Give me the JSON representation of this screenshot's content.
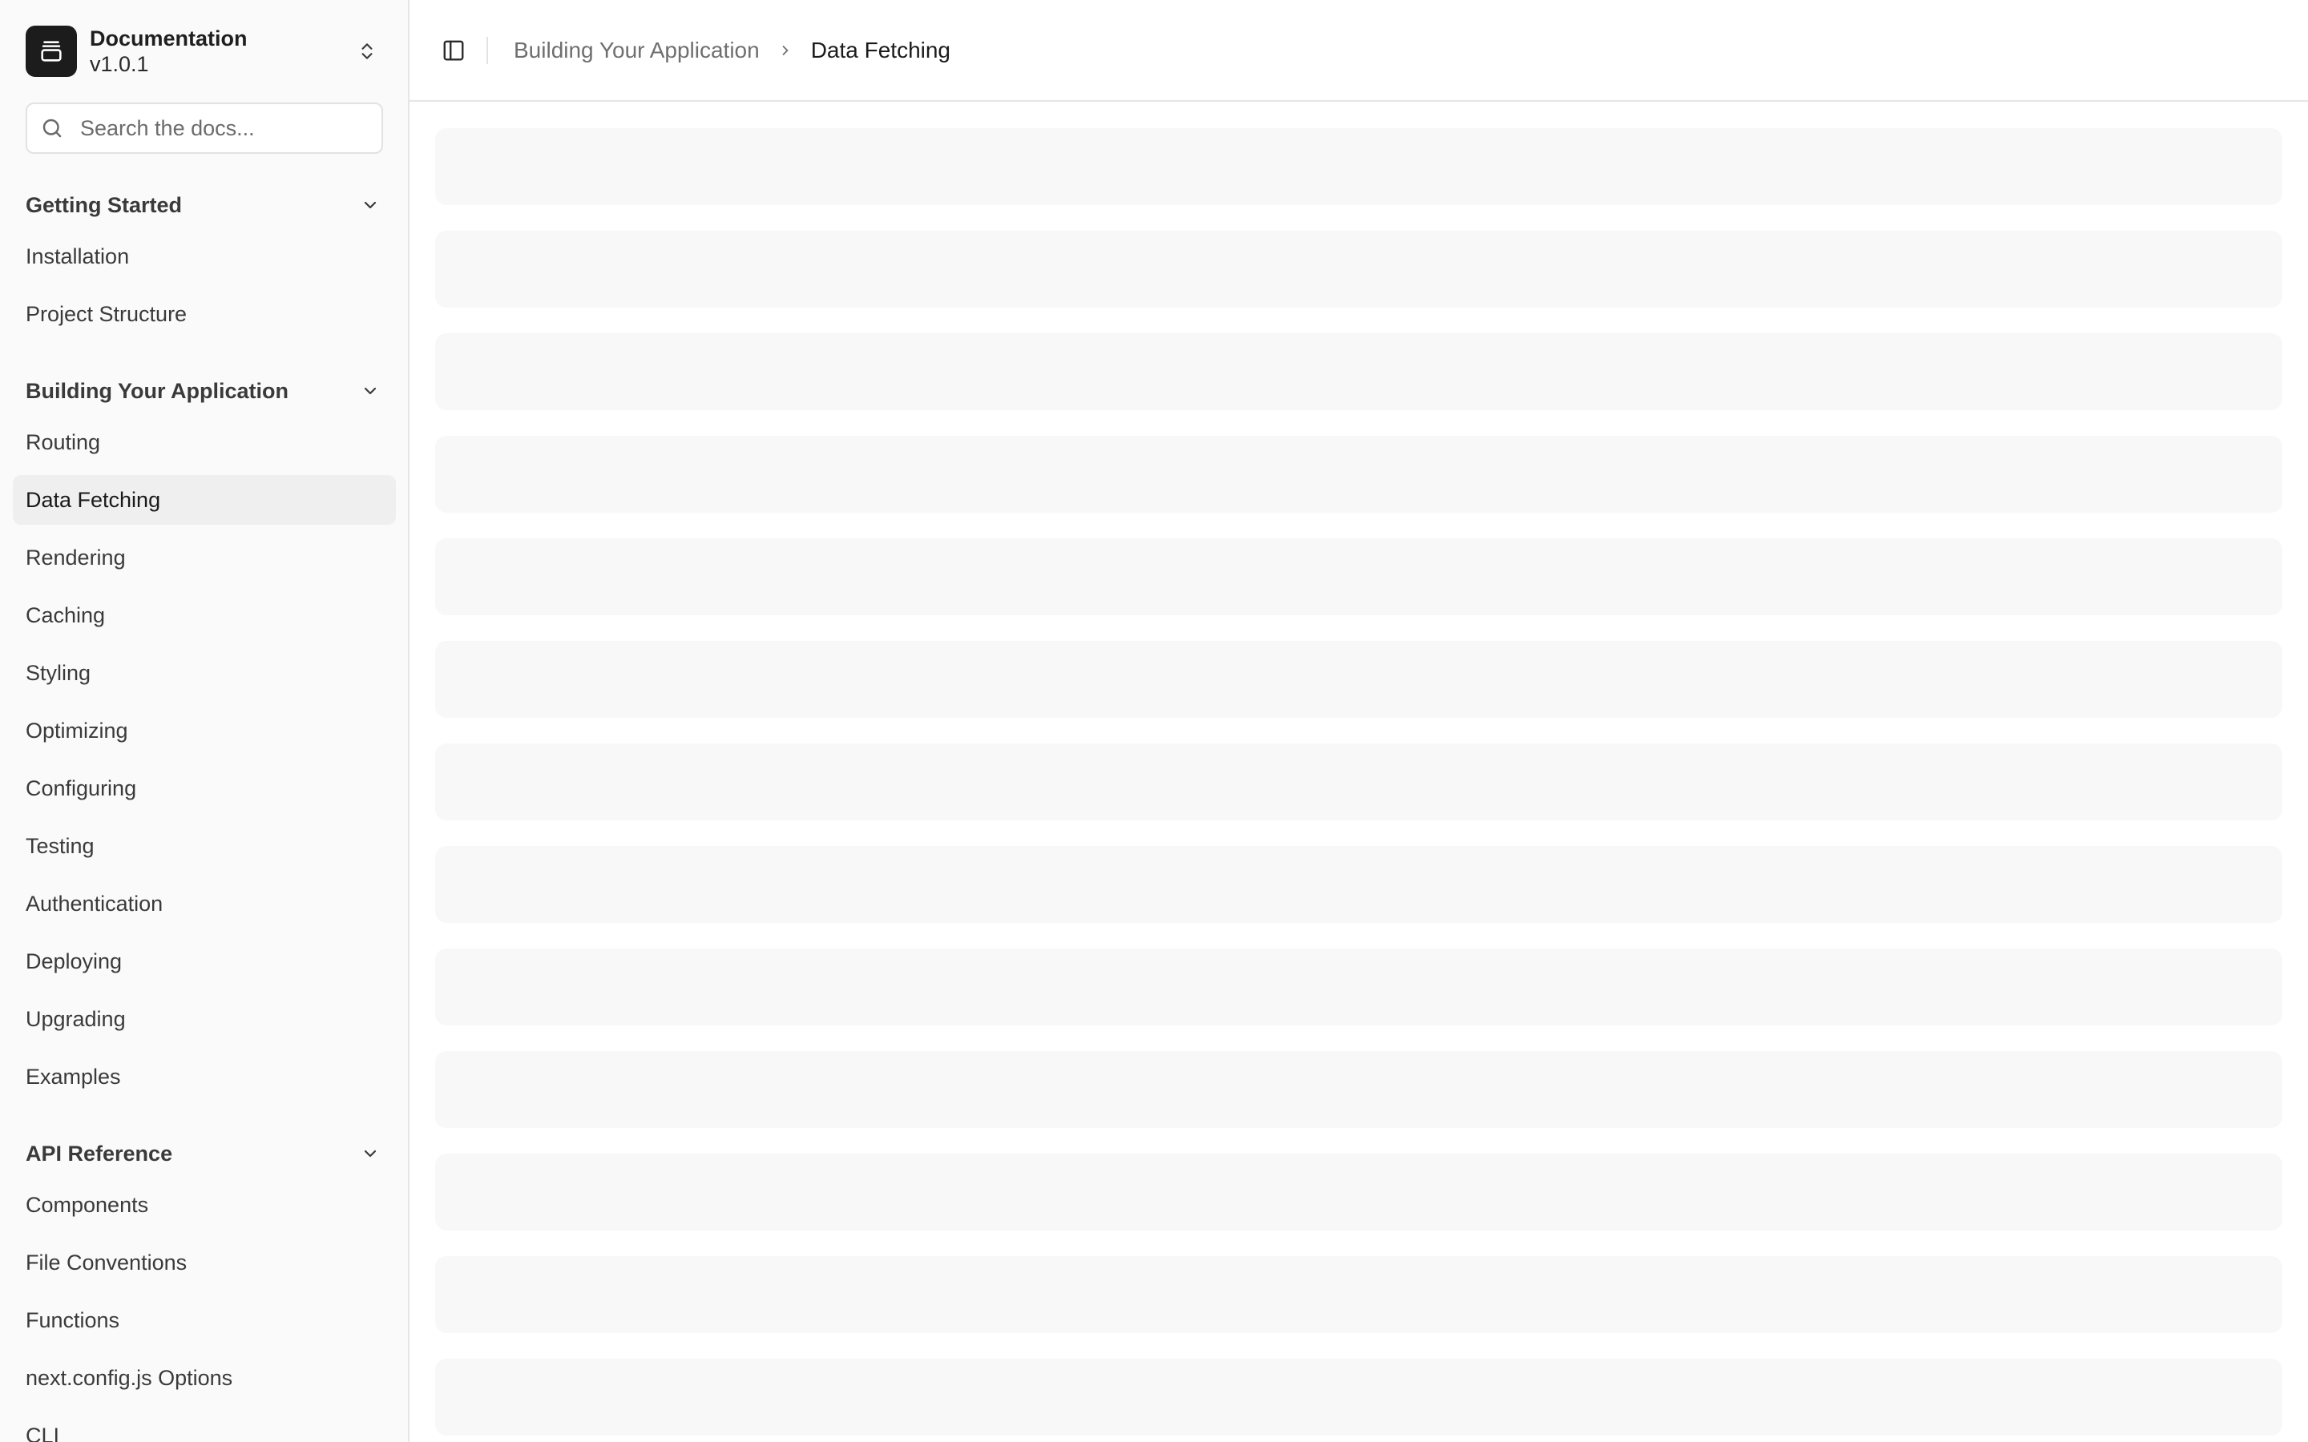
{
  "brand": {
    "title": "Documentation",
    "version": "v1.0.1"
  },
  "search": {
    "placeholder": "Search the docs..."
  },
  "sections": [
    {
      "title": "Getting Started",
      "items": [
        "Installation",
        "Project Structure"
      ]
    },
    {
      "title": "Building Your Application",
      "items": [
        "Routing",
        "Data Fetching",
        "Rendering",
        "Caching",
        "Styling",
        "Optimizing",
        "Configuring",
        "Testing",
        "Authentication",
        "Deploying",
        "Upgrading",
        "Examples"
      ]
    },
    {
      "title": "API Reference",
      "items": [
        "Components",
        "File Conventions",
        "Functions",
        "next.config.js Options",
        "CLI"
      ]
    }
  ],
  "active_item": "Data Fetching",
  "breadcrumb": {
    "parent": "Building Your Application",
    "current": "Data Fetching"
  },
  "colors": {
    "sidebar_bg": "#fafafa",
    "active_bg": "#efefef",
    "skeleton_bg": "#f8f8f8",
    "logo_bg": "#1c1c1c"
  },
  "skeleton_count": 13
}
